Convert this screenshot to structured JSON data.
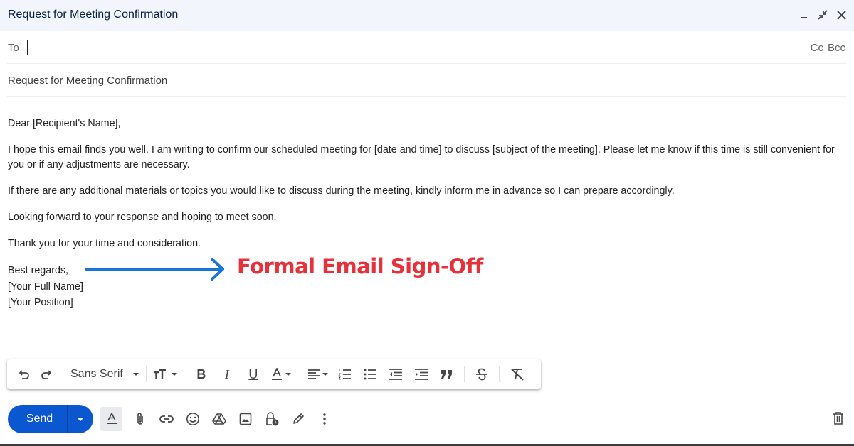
{
  "window": {
    "title": "Request for Meeting Confirmation",
    "controls": [
      "minimize-icon",
      "exit-fullscreen-icon",
      "close-icon"
    ]
  },
  "recipients": {
    "to_label": "To",
    "to_value": "",
    "cc_label": "Cc",
    "bcc_label": "Bcc"
  },
  "subject": "Request for Meeting Confirmation",
  "body": {
    "greeting": "Dear [Recipient's Name],",
    "paragraphs": [
      "I hope this email finds you well. I am writing to confirm our scheduled meeting for [date and time] to discuss [subject of the meeting]. Please let me know if this time is still convenient for you or if any adjustments are necessary.",
      "If there are any additional materials or topics you would like to discuss during the meeting, kindly inform me in advance so I can prepare accordingly.",
      "Looking forward to your response and hoping to meet soon.",
      "Thank you for your time and consideration."
    ],
    "signoff": "Best regards,",
    "name": "[Your Full Name]",
    "position": "[Your Position]"
  },
  "annotation": {
    "text": "Formal Email Sign-Off",
    "arrow_color": "#1a73d9",
    "text_color": "#e8303a"
  },
  "formatting_toolbar": {
    "font": "Sans Serif",
    "buttons": [
      "undo",
      "redo",
      "font",
      "text-size",
      "bold",
      "italic",
      "underline",
      "text-color",
      "align",
      "numbered-list",
      "bulleted-list",
      "indent-less",
      "indent-more",
      "quote",
      "strikethrough",
      "remove-formatting"
    ]
  },
  "actions": {
    "send_label": "Send",
    "tools": [
      "formatting-options",
      "attach-files",
      "insert-link",
      "insert-emoji",
      "insert-drive-file",
      "insert-photo",
      "confidential-mode",
      "insert-signature",
      "more-options"
    ]
  },
  "colors": {
    "accent": "#0b57d0",
    "header_bg": "#f2f6fc"
  }
}
